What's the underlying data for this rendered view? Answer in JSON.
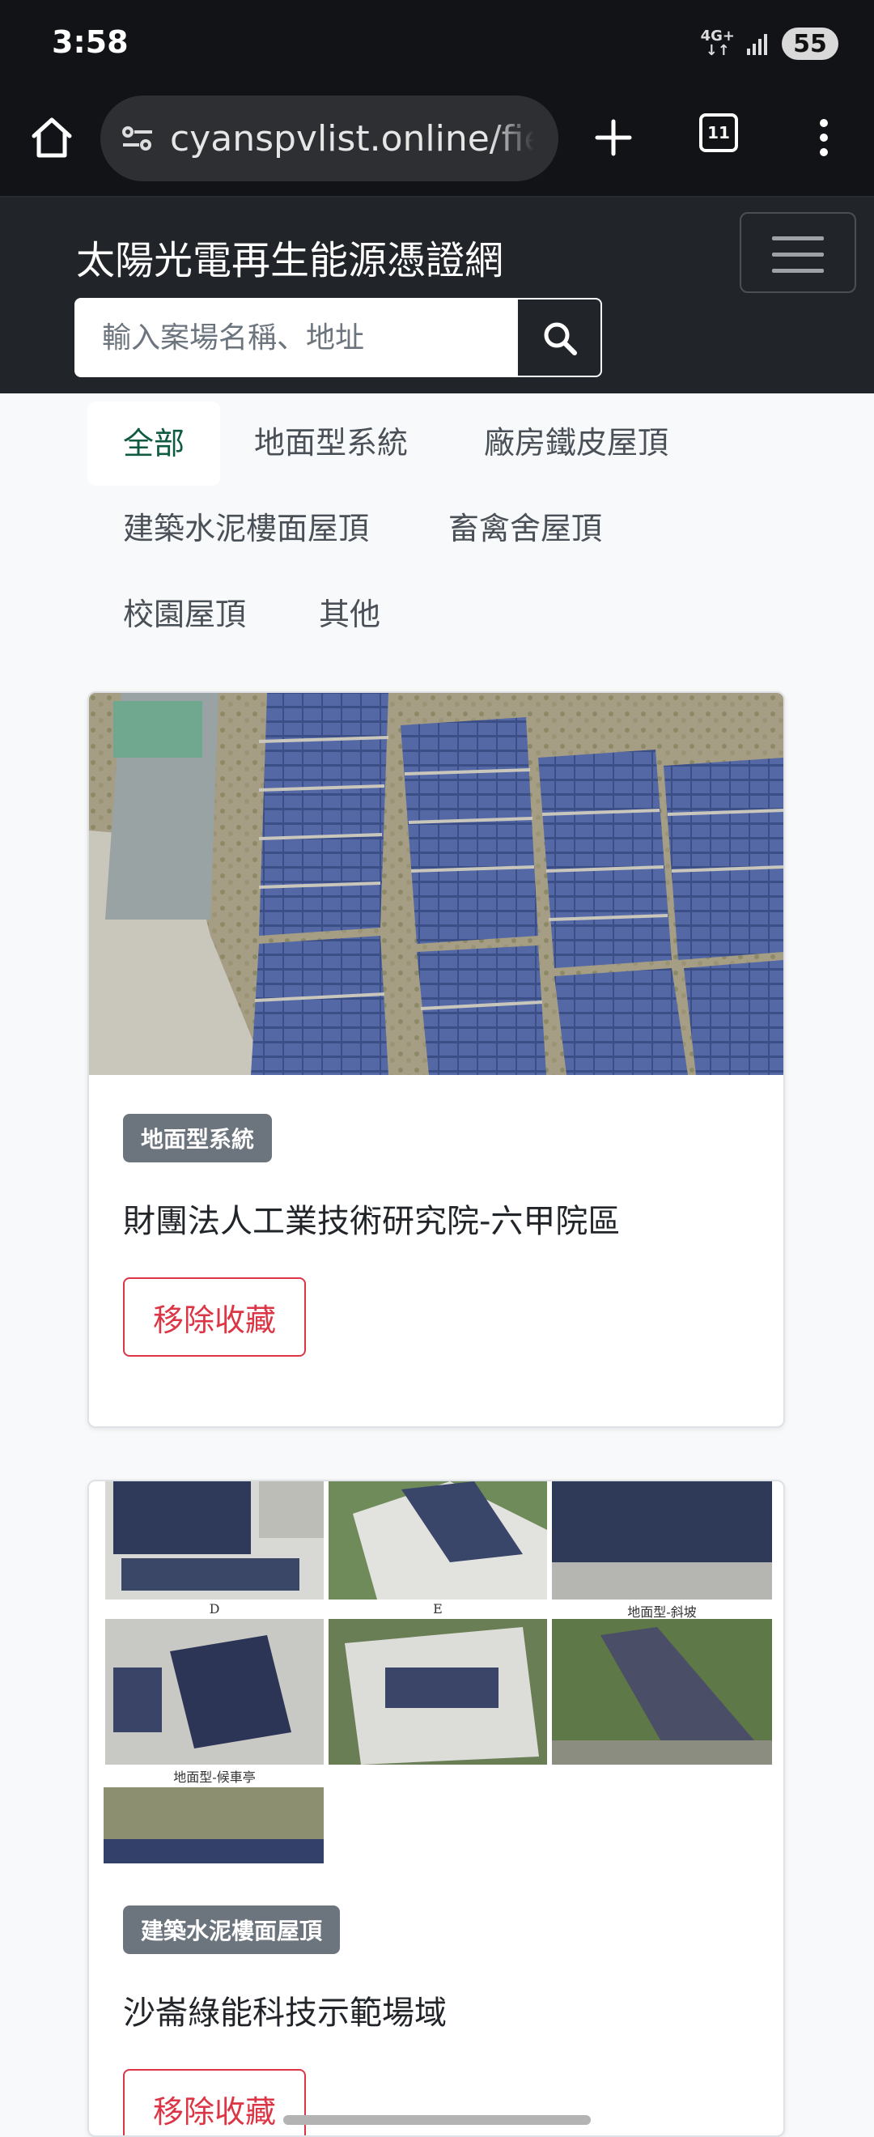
{
  "status_bar": {
    "time": "3:58",
    "network": "4G+",
    "battery": "55"
  },
  "browser": {
    "url": "cyanspvlist.online/field",
    "tab_count": "11"
  },
  "site": {
    "title": "太陽光電再生能源憑證網",
    "search_placeholder": "輸入案場名稱、地址"
  },
  "filters": [
    {
      "label": "全部",
      "active": true
    },
    {
      "label": "地面型系統"
    },
    {
      "label": "廠房鐵皮屋頂"
    },
    {
      "label": "建築水泥樓面屋頂"
    },
    {
      "label": "畜禽舍屋頂"
    },
    {
      "label": "校園屋頂"
    },
    {
      "label": "其他"
    }
  ],
  "cards": [
    {
      "category": "地面型系統",
      "title": "財團法人工業技術研究院-六甲院區",
      "action": "移除收藏"
    },
    {
      "category": "建築水泥樓面屋頂",
      "title": "沙崙綠能科技示範場域",
      "action": "移除收藏",
      "collage_captions": [
        "D",
        "E",
        "地面型-斜坡",
        "地面型-候車亭"
      ]
    }
  ],
  "colors": {
    "header": "#212529",
    "active_filter_text": "#0f5a40",
    "badge": "#6c757d",
    "danger": "#dc3545"
  }
}
